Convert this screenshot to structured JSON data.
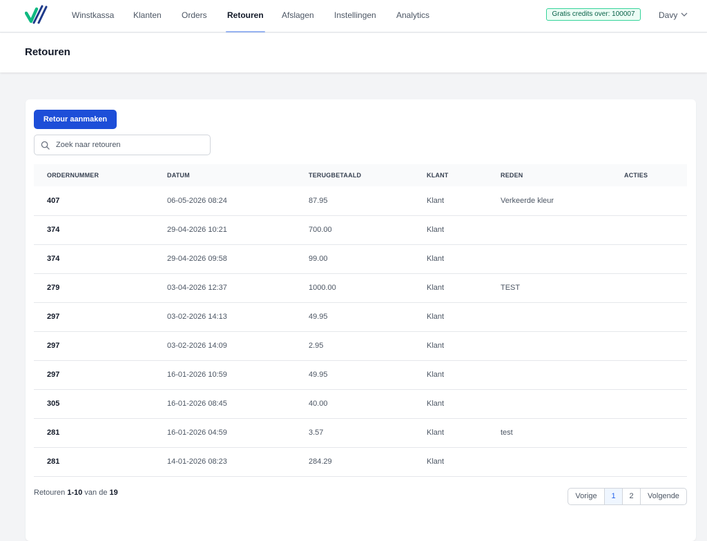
{
  "nav": {
    "items": [
      "Winstkassa",
      "Klanten",
      "Orders",
      "Retouren",
      "Afslagen",
      "Instellingen",
      "Analytics"
    ],
    "active": "Retouren",
    "credits": "Gratis credits over: 100007",
    "user": "Davy"
  },
  "page": {
    "title": "Retouren"
  },
  "toolbar": {
    "create_label": "Retour aanmaken",
    "search_placeholder": "Zoek naar retouren"
  },
  "table": {
    "headers": [
      "ORDERNUMMER",
      "DATUM",
      "TERUGBETAALD",
      "KLANT",
      "REDEN",
      "ACTIES"
    ],
    "rows": [
      [
        "407",
        "06-05-2026 08:24",
        "87.95",
        "Klant",
        "Verkeerde kleur",
        ""
      ],
      [
        "374",
        "29-04-2026 10:21",
        "700.00",
        "Klant",
        "",
        ""
      ],
      [
        "374",
        "29-04-2026 09:58",
        "99.00",
        "Klant",
        "",
        ""
      ],
      [
        "279",
        "03-04-2026 12:37",
        "1000.00",
        "Klant",
        "TEST",
        ""
      ],
      [
        "297",
        "03-02-2026 14:13",
        "49.95",
        "Klant",
        "",
        ""
      ],
      [
        "297",
        "03-02-2026 14:09",
        "2.95",
        "Klant",
        "",
        ""
      ],
      [
        "297",
        "16-01-2026 10:59",
        "49.95",
        "Klant",
        "",
        ""
      ],
      [
        "305",
        "16-01-2026 08:45",
        "40.00",
        "Klant",
        "",
        ""
      ],
      [
        "281",
        "16-01-2026 04:59",
        "3.57",
        "Klant",
        "test",
        ""
      ],
      [
        "281",
        "14-01-2026 08:23",
        "284.29",
        "Klant",
        "",
        ""
      ]
    ]
  },
  "pagination": {
    "prefix": "Retouren",
    "range": "1-10",
    "middle": "van de",
    "total": "19",
    "prev": "Vorige",
    "pages": [
      "1",
      "2"
    ],
    "current": "1",
    "next": "Volgende"
  },
  "colors": {
    "primary": "#1d4ed8",
    "credits_border": "#34d399",
    "credits_bg": "#ecfdf5"
  },
  "icons": {
    "logo": "checkmark-logo",
    "search": "search-icon",
    "user_menu": "chevron-down-icon"
  }
}
